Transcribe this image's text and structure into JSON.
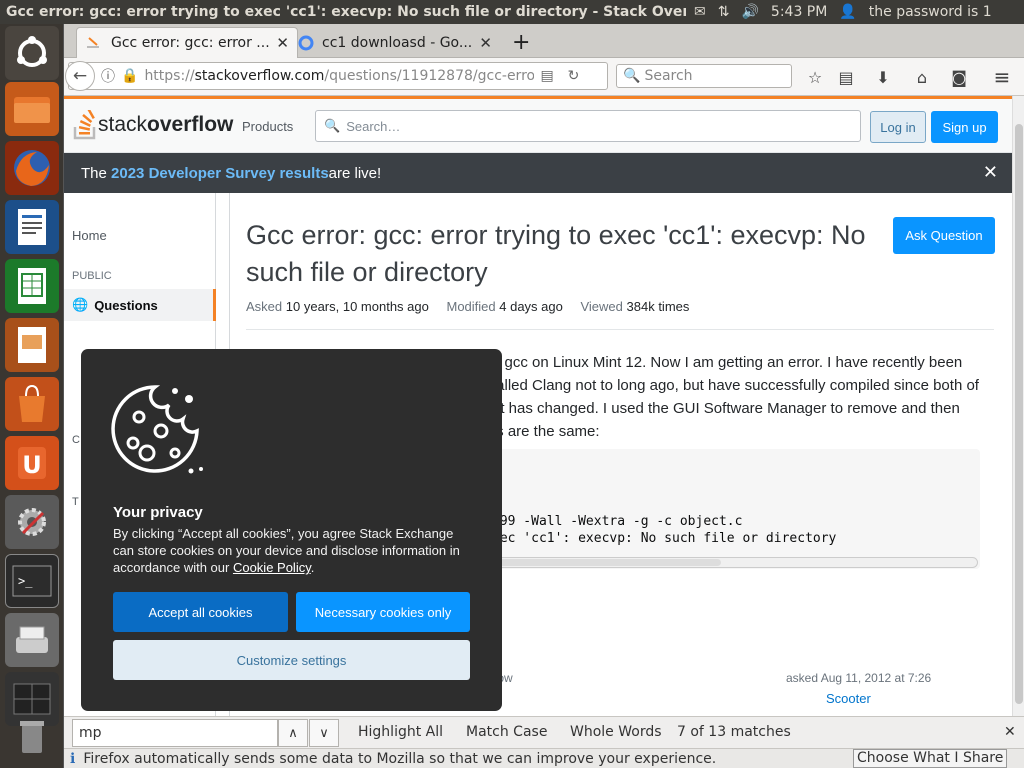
{
  "system": {
    "window_title": "Gcc error: gcc: error trying to exec 'cc1': execvp: No such file or directory - Stack Overflow - Mo",
    "clock": "5:43 PM",
    "user_label": "the password is 1"
  },
  "browser": {
    "tabs": [
      {
        "label": "Gcc error: gcc: error ..."
      },
      {
        "label": "cc1 downloasd - Go..."
      }
    ],
    "new_tab": "+",
    "url_prefix": "https://",
    "url_host": "stackoverflow.com",
    "url_path": "/questions/11912878/gcc-erro",
    "search_placeholder": "Search"
  },
  "so": {
    "logo_light": "stack",
    "logo_bold": "overflow",
    "products": "Products",
    "search_placeholder": "Search…",
    "login": "Log in",
    "signup": "Sign up",
    "banner_pre": "The ",
    "banner_link": "2023 Developer Survey results",
    "banner_post": " are live!",
    "nav_home": "Home",
    "nav_public": "PUBLIC",
    "nav_questions": "Questions",
    "nav_c": "C",
    "nav_t": "T",
    "title": "Gcc error: gcc: error trying to exec 'cc1': execvp: No such file or directory",
    "ask_button": "Ask Question",
    "asked_label": "Asked",
    "asked_value": "10 years, 10 months ago",
    "modified_label": "Modified",
    "modified_value": "4 days ago",
    "viewed_label": "Viewed",
    "viewed_value": "384k times",
    "body_lines": [
      "g gcc on Linux Mint 12. Now I am getting an error. I have recently been",
      "talled Clang not to long ago, but have successfully compiled since both of",
      "at has changed. I used the GUI Software Manager to remove and then",
      "ts are the same:"
    ],
    "code_lines": [
      "c99 -Wall -Wextra -g -c object.c",
      "xec 'cc1': execvp: No such file or directory"
    ],
    "flow_fragment": "llow",
    "asked_date": "asked Aug 11, 2012 at 7:26",
    "author": "Scooter"
  },
  "cookie": {
    "heading": "Your privacy",
    "text": "By clicking “Accept all cookies”, you agree Stack Exchange can store cookies on your device and disclose information in accordance with our ",
    "policy_link": "Cookie Policy",
    "accept": "Accept all cookies",
    "necessary": "Necessary cookies only",
    "customize": "Customize settings"
  },
  "find": {
    "query": "mp",
    "highlight_all": "Highlight All",
    "match_case": "Match Case",
    "whole_words": "Whole Words",
    "matches": "7 of 13 matches"
  },
  "notification": {
    "text": "Firefox automatically sends some data to Mozilla so that we can improve your experience.",
    "button": "Choose What I Share"
  },
  "colors": {
    "so_orange": "#f48225",
    "so_blue": "#0a95ff",
    "banner_bg": "#3b4045",
    "cookie_bg": "#2d2d2d",
    "cookie_accept": "#0a6cc4",
    "ubuntu_panel": "#3c3b37"
  }
}
